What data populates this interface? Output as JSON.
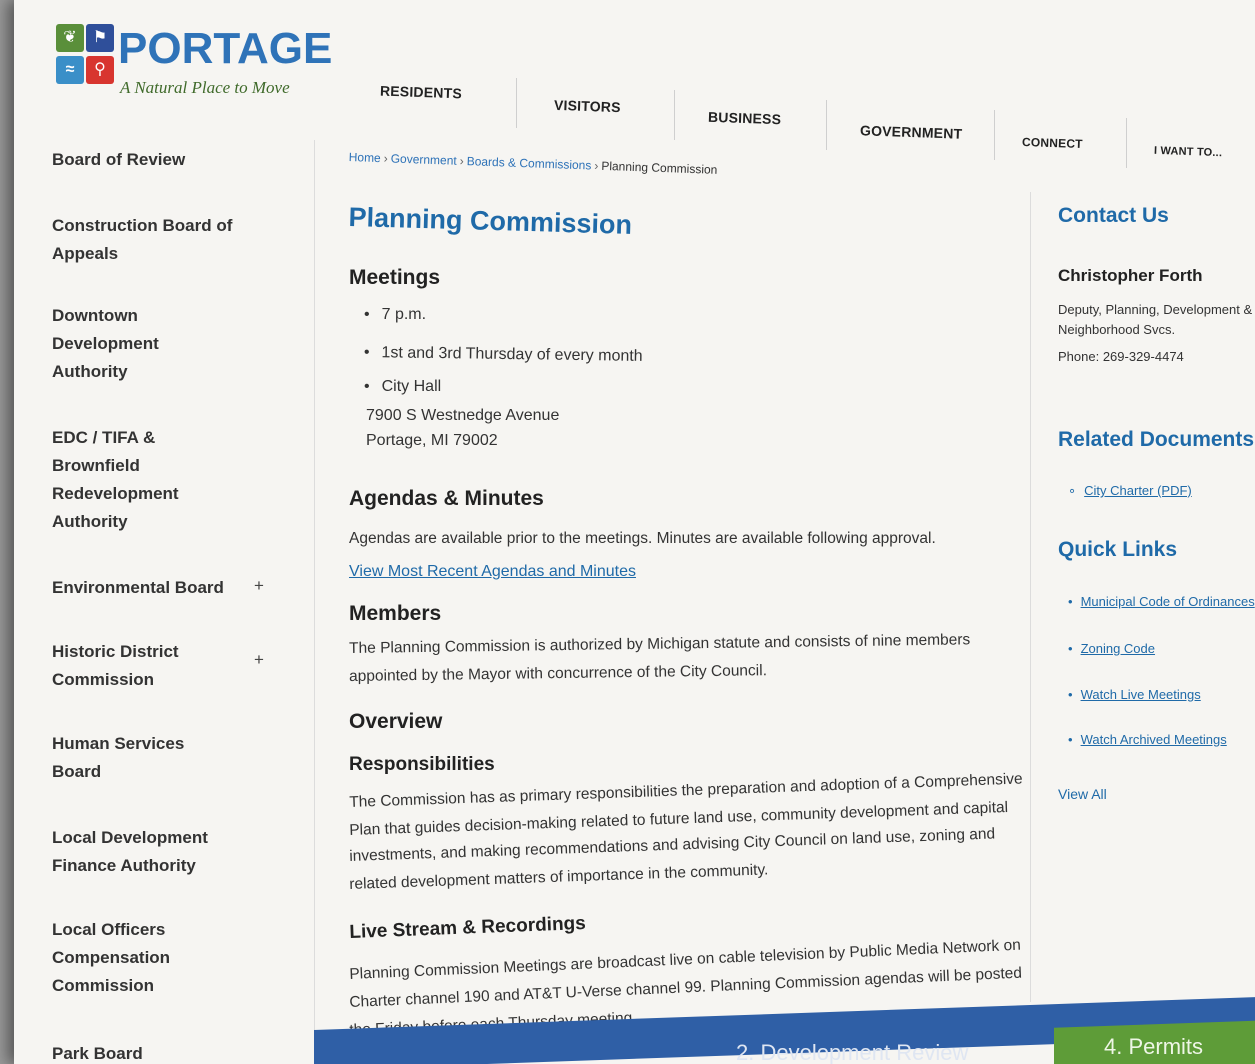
{
  "logo": {
    "name": "PORTAGE",
    "tagline": "A Natural Place to Move"
  },
  "nav": {
    "items": [
      "RESIDENTS",
      "VISITORS",
      "BUSINESS",
      "GOVERNMENT",
      "CONNECT",
      "I WANT TO..."
    ]
  },
  "sidebar": {
    "items": [
      {
        "label": "Board of Review"
      },
      {
        "label": "Construction Board of Appeals"
      },
      {
        "label": "Downtown Development Authority"
      },
      {
        "label": "EDC / TIFA & Brownfield Redevelopment Authority"
      },
      {
        "label": "Environmental Board",
        "expand": "+"
      },
      {
        "label": "Historic District Commission",
        "expand": "+"
      },
      {
        "label": "Human Services Board"
      },
      {
        "label": "Local Development Finance Authority"
      },
      {
        "label": "Local Officers Compensation Commission"
      },
      {
        "label": "Park Board"
      }
    ]
  },
  "breadcrumb": {
    "items": [
      "Home",
      "Government",
      "Boards & Commissions"
    ],
    "separator": "›",
    "current": "Planning Commission"
  },
  "main": {
    "title": "Planning Commission",
    "meetings_heading": "Meetings",
    "meeting_bullets": [
      "7 p.m.",
      "1st and 3rd Thursday of every month",
      "City Hall"
    ],
    "address_line1": "7900 S Westnedge Avenue",
    "address_line2": "Portage, MI 79002",
    "agendas_heading": "Agendas & Minutes",
    "agendas_text": "Agendas are available prior to the meetings. Minutes are available following approval.",
    "agendas_link": "View Most Recent Agendas and Minutes",
    "members_heading": "Members",
    "members_line1": "The Planning Commission is authorized by Michigan statute and consists of nine members",
    "members_line2": "appointed by the Mayor with concurrence of the City Council.",
    "overview_heading": "Overview",
    "responsibilities_heading": "Responsibilities",
    "resp_line1": "The Commission has as primary responsibilities the preparation and adoption of a Comprehensive",
    "resp_line2": "Plan that guides decision-making related to future land use, community development and capital",
    "resp_line3": "investments, and making recommendations and advising City Council on land use, zoning and",
    "resp_line4": "related development matters of importance in the community.",
    "livestream_heading": "Live Stream & Recordings",
    "live_line1": "Planning Commission Meetings are broadcast live on cable television by Public Media Network on",
    "live_line2": "Charter channel 190 and AT&T U-Verse channel 99. Planning Commission agendas will be posted",
    "live_line3": "the Friday before each Thursday meeting."
  },
  "right": {
    "contact_heading": "Contact Us",
    "contact_name": "Christopher Forth",
    "contact_title1": "Deputy, Planning, Development &",
    "contact_title2": "Neighborhood Svcs.",
    "contact_phone": "Phone: 269-329-4474",
    "related_heading": "Related Documents",
    "related_links": [
      "City Charter (PDF)"
    ],
    "quick_heading": "Quick Links",
    "quick_links": [
      "Municipal Code of Ordinances",
      "Zoning Code",
      "Watch Live Meetings",
      "Watch Archived Meetings"
    ],
    "view_all": "View All"
  },
  "footer": {
    "item1": "2. Development Review",
    "item2": "4. Permits"
  },
  "colors": {
    "brand_blue": "#1f6aa8",
    "brand_green": "#5e9c38",
    "page_bg": "#f6f5f2"
  }
}
